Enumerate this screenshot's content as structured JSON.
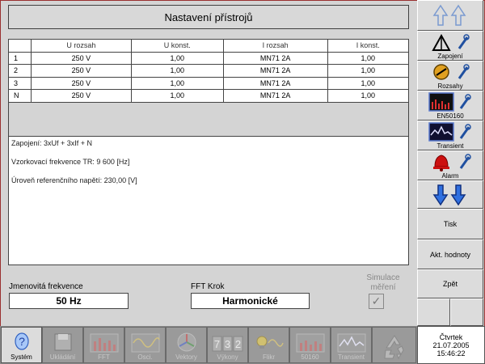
{
  "title": "Nastavení přístrojů",
  "table": {
    "headers": [
      "",
      "U rozsah",
      "U konst.",
      "I rozsah",
      "I konst."
    ],
    "rows": [
      [
        "1",
        "250 V",
        "1,00",
        "MN71 2A",
        "1,00"
      ],
      [
        "2",
        "250 V",
        "1,00",
        "MN71 2A",
        "1,00"
      ],
      [
        "3",
        "250 V",
        "1,00",
        "MN71 2A",
        "1,00"
      ],
      [
        "N",
        "250 V",
        "1,00",
        "MN71 2A",
        "1,00"
      ]
    ]
  },
  "info": {
    "zapojeni": "Zapojení:  3xUf + 3xIf + N",
    "vzorkovaci": "Vzorkovací frekvence TR:  9 600 [Hz]",
    "uroven": "Úroveň referenčního napětí:  230,00 [V]"
  },
  "fields": {
    "freq_label": "Jmenovitá frekvence",
    "freq_value": "50 Hz",
    "fft_label": "FFT Krok",
    "fft_value": "Harmonické",
    "sim_label": "Simulace měření"
  },
  "right_panel": {
    "zapojeni": "Zapojení",
    "rozsahy": "Rozsahy",
    "en50160": "EN50160",
    "transient": "Transient",
    "alarm": "Alarm",
    "tisk": "Tisk",
    "akt_hodnoty": "Akt. hodnoty",
    "zpet": "Zpět"
  },
  "toolbar": {
    "items": [
      "Systém",
      "Ukládání",
      "FFT",
      "Osci.",
      "Vektory",
      "Výkony",
      "Flikr",
      "50160",
      "Transient"
    ],
    "vykony_digits": "732"
  },
  "clock": {
    "day": "Čtvrtek",
    "date": "21.07.2005",
    "time": "15:46:22"
  },
  "colors": {
    "background": "#d4d4d4",
    "border_accent": "#9a3030",
    "arrow_blue": "#2050c0",
    "alarm_red": "#cc1010"
  }
}
